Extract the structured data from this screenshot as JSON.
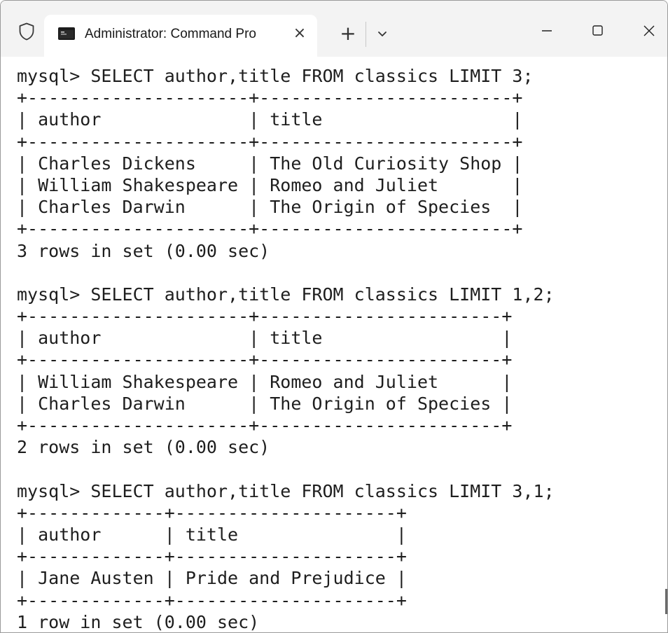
{
  "window": {
    "tab_title": "Administrator: Command Pro",
    "tab_close_glyph": "×",
    "new_tab_glyph": "+"
  },
  "icons": {
    "shield": "shield-icon",
    "terminal": "cmd-icon",
    "close_tab": "close-icon",
    "new_tab": "plus-icon",
    "dropdown": "chevron-down-icon",
    "minimize": "minimize-icon",
    "maximize": "maximize-icon",
    "close_window": "close-icon"
  },
  "terminal": {
    "lines": [
      "mysql> SELECT author,title FROM classics LIMIT 3;",
      "+---------------------+------------------------+",
      "| author              | title                  |",
      "+---------------------+------------------------+",
      "| Charles Dickens     | The Old Curiosity Shop |",
      "| William Shakespeare | Romeo and Juliet       |",
      "| Charles Darwin      | The Origin of Species  |",
      "+---------------------+------------------------+",
      "3 rows in set (0.00 sec)",
      "",
      "mysql> SELECT author,title FROM classics LIMIT 1,2;",
      "+---------------------+-----------------------+",
      "| author              | title                 |",
      "+---------------------+-----------------------+",
      "| William Shakespeare | Romeo and Juliet      |",
      "| Charles Darwin      | The Origin of Species |",
      "+---------------------+-----------------------+",
      "2 rows in set (0.00 sec)",
      "",
      "mysql> SELECT author,title FROM classics LIMIT 3,1;",
      "+-------------+---------------------+",
      "| author      | title               |",
      "+-------------+---------------------+",
      "| Jane Austen | Pride and Prejudice |",
      "+-------------+---------------------+",
      "1 row in set (0.00 sec)"
    ]
  }
}
